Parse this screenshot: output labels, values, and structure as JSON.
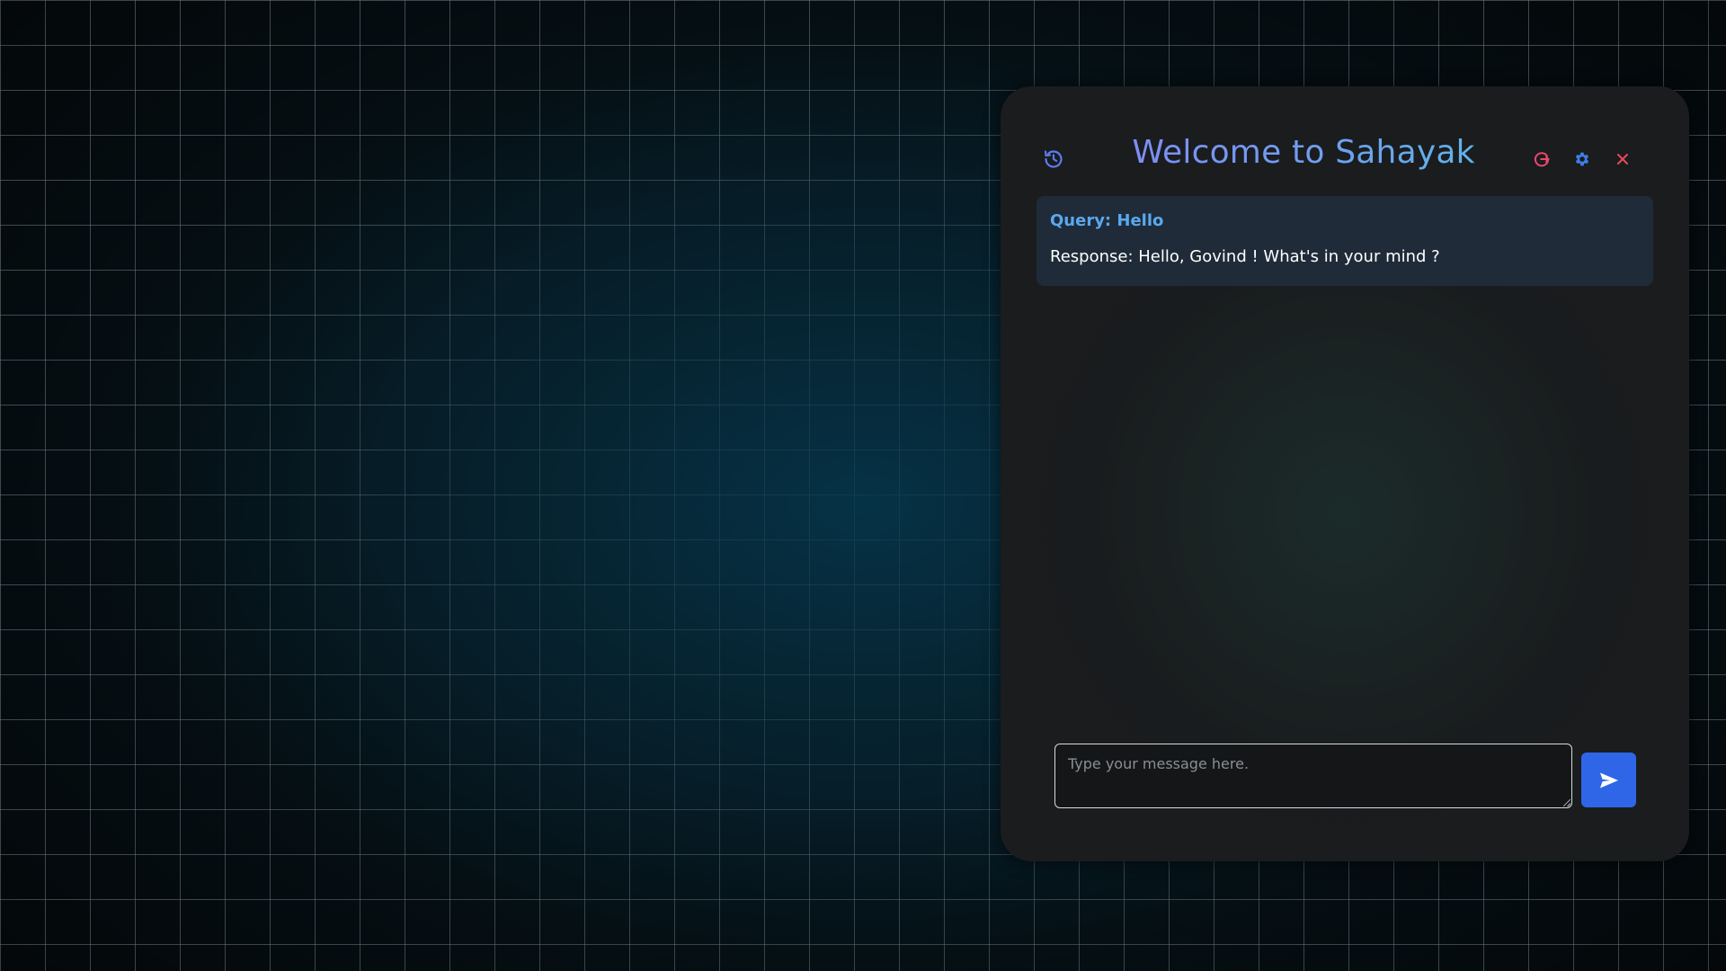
{
  "app": {
    "title": "Welcome to Sahayak"
  },
  "header": {
    "icons": {
      "history": "history-icon",
      "refresh": "logout-refresh-icon",
      "settings": "gear-icon",
      "close": "close-icon"
    }
  },
  "chat": {
    "messages": [
      {
        "query": "Query: Hello",
        "response": "Response: Hello, Govind ! What's in your mind ?"
      }
    ]
  },
  "composer": {
    "placeholder": "Type your message here.",
    "value": "",
    "send_icon": "send-icon"
  },
  "colors": {
    "title_gradient_start": "#7f8cf4",
    "title_gradient_end": "#5fb6e8",
    "history_icon": "#5b7cf0",
    "refresh_icon": "#e8496b",
    "settings_icon": "#3f7fe8",
    "close_icon": "#e8495a",
    "query_text": "#5aa8f0",
    "send_button": "#2f66e8",
    "card_bg": "#1f2b38",
    "panel_bg": "#1a1c1e"
  }
}
